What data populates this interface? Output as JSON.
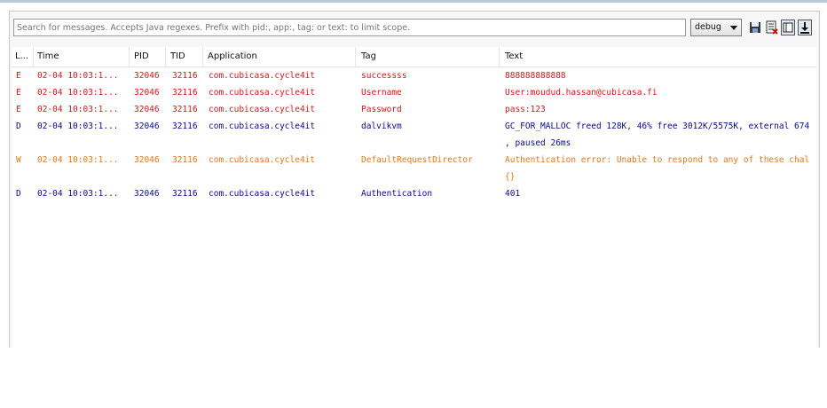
{
  "search": {
    "placeholder": "Search for messages. Accepts Java regexes. Prefix with pid:, app:, tag: or text: to limit scope."
  },
  "log_level": {
    "selected": "debug"
  },
  "toolbar_icons": [
    "save-icon",
    "clear-log-icon",
    "toggle-panel-icon",
    "scroll-lock-icon"
  ],
  "columns": {
    "level": "L...",
    "time": "Time",
    "pid": "PID",
    "tid": "TID",
    "application": "Application",
    "tag": "Tag",
    "text": "Text"
  },
  "rows": [
    {
      "level": "E",
      "time": "02-04 10:03:1...",
      "pid": "32046",
      "tid": "32116",
      "app": "com.cubicasa.cycle4it",
      "tag": "successss",
      "text": "888888888888",
      "text2": ""
    },
    {
      "level": "E",
      "time": "02-04 10:03:1...",
      "pid": "32046",
      "tid": "32116",
      "app": "com.cubicasa.cycle4it",
      "tag": "Username",
      "text": "User:moudud.hassan@cubicasa.fi",
      "text2": ""
    },
    {
      "level": "E",
      "time": "02-04 10:03:1...",
      "pid": "32046",
      "tid": "32116",
      "app": "com.cubicasa.cycle4it",
      "tag": "Password",
      "text": "pass:123",
      "text2": ""
    },
    {
      "level": "D",
      "time": "02-04 10:03:1...",
      "pid": "32046",
      "tid": "32116",
      "app": "com.cubicasa.cycle4it",
      "tag": "dalvikvm",
      "text": "GC_FOR_MALLOC freed 128K, 46% free 3012K/5575K, external 674",
      "text2": ", paused 26ms"
    },
    {
      "level": "W",
      "time": "02-04 10:03:1...",
      "pid": "32046",
      "tid": "32116",
      "app": "com.cubicasa.cycle4it",
      "tag": "DefaultRequestDirector",
      "text": "Authentication error: Unable to respond to any of these chal",
      "text2": " {}"
    },
    {
      "level": "D",
      "time": "02-04 10:03:1...",
      "pid": "32046",
      "tid": "32116",
      "app": "com.cubicasa.cycle4it",
      "tag": "Authentication",
      "text": "401",
      "text2": ""
    }
  ]
}
